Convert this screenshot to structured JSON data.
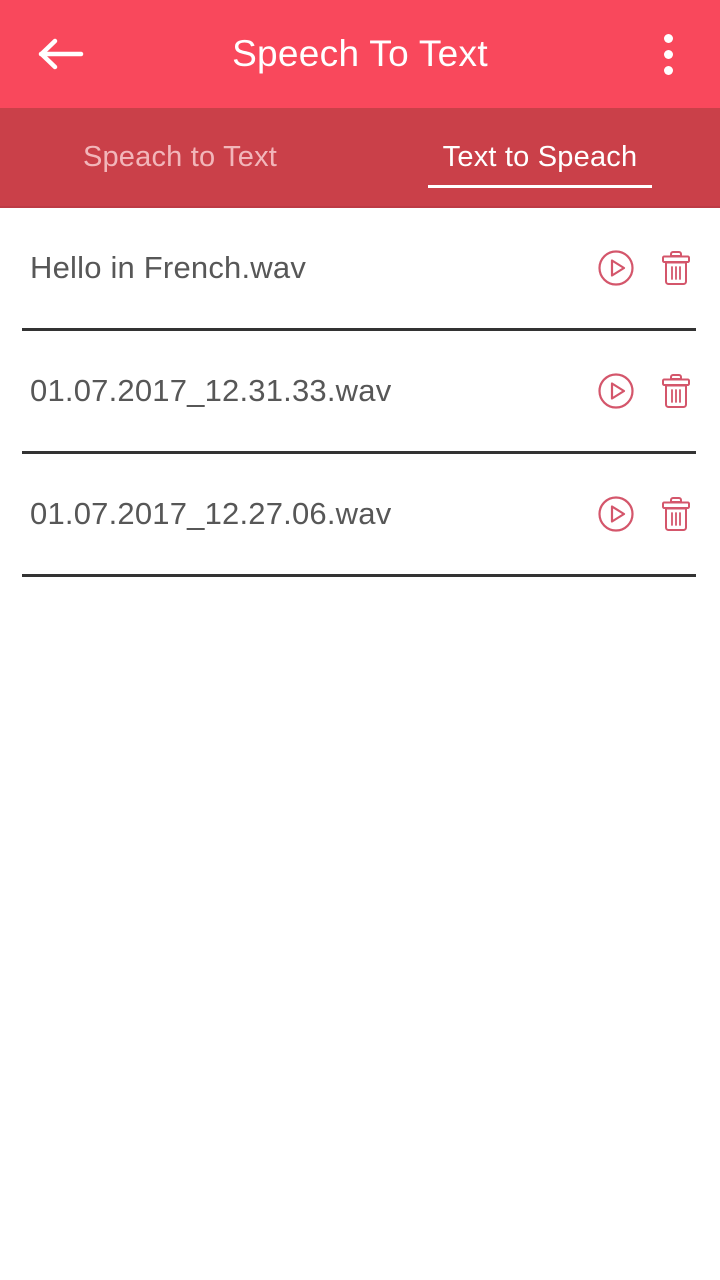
{
  "appbar": {
    "title": "Speech To Text",
    "back_icon": "arrow-left-icon",
    "overflow_icon": "overflow-menu-icon",
    "background_color": "#f9485c"
  },
  "tabs": {
    "background_color": "#ca4049",
    "items": [
      {
        "label": "Speach to Text",
        "active": false
      },
      {
        "label": "Text to Speach",
        "active": true
      }
    ]
  },
  "list": {
    "play_icon": "play-circle-icon",
    "delete_icon": "trash-icon",
    "accent_color": "#d4566b",
    "items": [
      {
        "name": "Hello in French.wav"
      },
      {
        "name": "01.07.2017_12.31.33.wav"
      },
      {
        "name": "01.07.2017_12.27.06.wav"
      }
    ]
  }
}
